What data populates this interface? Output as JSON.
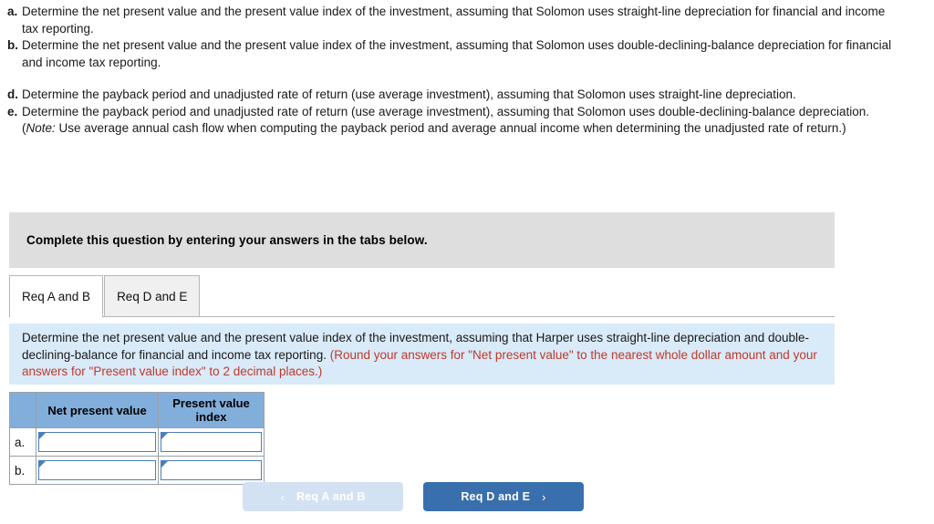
{
  "requirements": {
    "group1": [
      {
        "letter": "a.",
        "text": "Determine the net present value and the present value index of the investment, assuming that Solomon uses straight-line depreciation for financial and income tax reporting."
      },
      {
        "letter": "b.",
        "text": "Determine the net present value and the present value index of the investment, assuming that Solomon uses double-declining-balance depreciation for financial and income tax reporting."
      }
    ],
    "group2": [
      {
        "letter": "d.",
        "text": "Determine the payback period and unadjusted rate of return (use average investment), assuming that Solomon uses straight-line depreciation."
      },
      {
        "letter": "e.",
        "text_before_note": "Determine the payback period and unadjusted rate of return (use average investment), assuming that Solomon uses double-declining-balance depreciation. (",
        "note_label": "Note:",
        "text_after_note": " Use average annual cash flow when computing the payback period and average annual income when determining the unadjusted rate of return.)"
      }
    ]
  },
  "complete_bar": {
    "text": "Complete this question by entering your answers in the tabs below."
  },
  "tabs": [
    {
      "label": "Req A and B",
      "state": "active"
    },
    {
      "label": "Req D and E",
      "state": "inactive"
    }
  ],
  "instruction_panel": {
    "black_text": "Determine the net present value and the present value index of the investment, assuming that Harper uses straight-line depreciation and double-declining-balance for financial and income tax reporting. ",
    "red_text": "(Round your answers for \"Net present value\" to the nearest whole dollar amount and your answers for \"Present value index\" to 2 decimal places.)"
  },
  "answer_table": {
    "headers": [
      "",
      "Net present value",
      "Present value index"
    ],
    "rows": [
      {
        "label": "a.",
        "net_present_value": "",
        "present_value_index": ""
      },
      {
        "label": "b.",
        "net_present_value": "",
        "present_value_index": ""
      }
    ]
  },
  "nav": {
    "prev_label": "Req A and B",
    "prev_chevron": "‹",
    "next_label": "Req D and E",
    "next_chevron": "›"
  },
  "colors": {
    "panel_blue": "#d9eaf8",
    "header_blue": "#82aedb",
    "button_blue": "#3a6fad",
    "button_disabled": "#d3e2f2",
    "red_note": "#c0392b",
    "gray_bar": "#dedede",
    "input_border": "#4a7ebb"
  }
}
